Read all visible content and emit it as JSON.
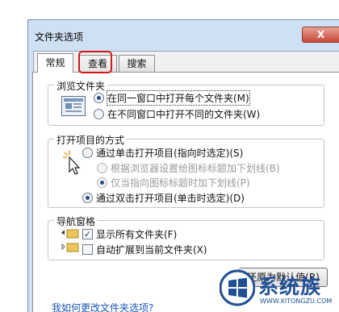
{
  "window": {
    "title": "文件夹选项",
    "close_symbol": "X"
  },
  "tabs": [
    {
      "label": "常规",
      "active": true
    },
    {
      "label": "查看",
      "active": false,
      "highlighted": true
    },
    {
      "label": "搜索",
      "active": false
    }
  ],
  "browse_folders": {
    "title": "浏览文件夹",
    "icon": "window-preview-icon",
    "options": [
      {
        "label": "在同一窗口中打开每个文件夹(M)",
        "selected": true
      },
      {
        "label": "在不同窗口中打开不同的文件夹(W)",
        "selected": false
      }
    ]
  },
  "open_items": {
    "title": "打开项目的方式",
    "icon": "click-cursor-icon",
    "single_click": {
      "label": "通过单击打开项目(指向时选定)(S)",
      "selected": false
    },
    "sub_options": [
      {
        "label": "根据浏览器设置给图标标题加下划线(B)",
        "selected": false,
        "disabled": true
      },
      {
        "label": "仅当指向图标标题时加下划线(P)",
        "selected": true,
        "disabled": true
      }
    ],
    "double_click": {
      "label": "通过双击打开项目(单击时选定)(D)",
      "selected": true
    }
  },
  "nav_pane": {
    "title": "导航窗格",
    "options": [
      {
        "label": "显示所有文件夹(F)",
        "checked": true
      },
      {
        "label": "自动扩展到当前文件夹(X)",
        "checked": false
      }
    ]
  },
  "buttons": {
    "restore_defaults": "还原为默认值(R)"
  },
  "help_link": "我如何更改文件夹选项?",
  "watermark": {
    "brand": "系统族",
    "url": "WWW.XITONGZU.COM"
  },
  "colors": {
    "highlight": "#d21818",
    "link": "#1a56b8",
    "selected_radio": "#1f4f8f"
  }
}
